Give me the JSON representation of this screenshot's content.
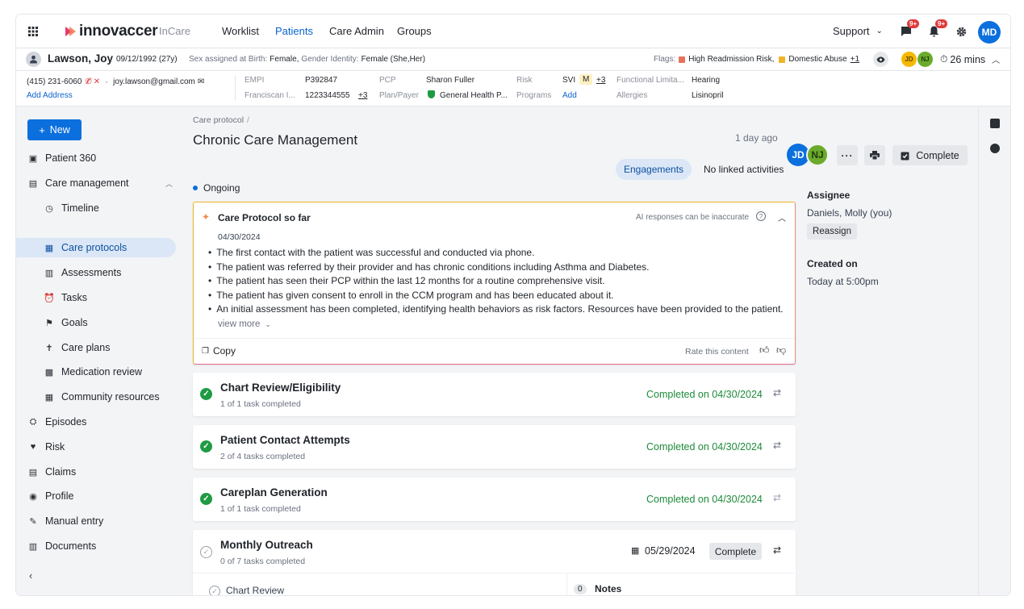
{
  "nav": {
    "brand": "innovaccer",
    "product": "InCare",
    "links": [
      "Worklist",
      "Patients",
      "Care Admin",
      "Groups"
    ],
    "active_link": "Patients",
    "support": "Support",
    "messages_badge": "9+",
    "notifications_badge": "9+",
    "user_initials": "MD"
  },
  "patient": {
    "name": "Lawson, Joy",
    "dob": "09/12/1992 (27y)",
    "sex_label": "Sex assigned at Birth:",
    "sex_value": "Female,",
    "gender_label": "Gender Identity:",
    "gender_value": "Female (She,Her)",
    "flags_label": "Flags:",
    "flag1": "High Readmission Risk,",
    "flag2": "Domestic Abuse",
    "flag_more": "+1",
    "timer": "26 mins",
    "care_team": [
      "JD",
      "NJ"
    ]
  },
  "info": {
    "phone": "(415) 231-6060",
    "email": "joy.lawson@gmail.com",
    "add_address": "Add Address",
    "empi_label": "EMPI",
    "empi_value": "P392847",
    "franciscan_label": "Franciscan I...",
    "franciscan_value": "1223344555",
    "franciscan_more": "+3",
    "pcp_label": "PCP",
    "pcp_value": "Sharon Fuller",
    "plan_label": "Plan/Payer",
    "plan_value": "General Health P...",
    "risk_label": "Risk",
    "risk_value": "SVI",
    "risk_level": "M",
    "risk_more": "+3",
    "programs_label": "Programs",
    "programs_value": "Add",
    "functional_label": "Functional Limita...",
    "functional_value": "Hearing",
    "allergies_label": "Allergies",
    "allergies_value": "Lisinopril"
  },
  "sidebar": {
    "new_label": "New",
    "items": [
      {
        "label": "Patient 360",
        "icon": "id-card-icon"
      },
      {
        "label": "Care management",
        "icon": "chat-icon"
      },
      {
        "label": "Timeline",
        "icon": "history-icon"
      },
      {
        "label": "Care protocols",
        "icon": "protocol-icon"
      },
      {
        "label": "Assessments",
        "icon": "clipboard-icon"
      },
      {
        "label": "Tasks",
        "icon": "alarm-icon"
      },
      {
        "label": "Goals",
        "icon": "goal-icon"
      },
      {
        "label": "Care plans",
        "icon": "care-plan-icon"
      },
      {
        "label": "Medication review",
        "icon": "medication-icon"
      },
      {
        "label": "Community resources",
        "icon": "building-icon"
      },
      {
        "label": "Episodes",
        "icon": "episodes-icon"
      },
      {
        "label": "Risk",
        "icon": "heart-icon"
      },
      {
        "label": "Claims",
        "icon": "claims-icon"
      },
      {
        "label": "Profile",
        "icon": "profile-icon"
      },
      {
        "label": "Manual entry",
        "icon": "manual-entry-icon"
      },
      {
        "label": "Documents",
        "icon": "documents-icon"
      }
    ]
  },
  "main": {
    "breadcrumb": "Care protocol",
    "breadcrumb_sep": "/",
    "title": "Chronic Care Management",
    "updated": "1 day ago",
    "assignees": [
      "JD",
      "NJ"
    ],
    "complete_label": "Complete",
    "engagements_label": "Engagements",
    "linked": "No linked activities",
    "status": "Ongoing",
    "assignee_label": "Assignee",
    "assignee_value": "Daniels, Molly (you)",
    "reassign_label": "Reassign",
    "created_label": "Created on",
    "created_value": "Today at 5:00pm"
  },
  "ai_card": {
    "title": "Care Protocol so far",
    "disclaimer": "AI responses can be inaccurate",
    "date": "04/30/2024",
    "bullets": [
      "The first contact with the patient was successful and conducted via phone.",
      "The patient was referred by their provider and has chronic conditions including Asthma and Diabetes.",
      "The patient has seen their PCP within the last 12 months for a routine comprehensive visit.",
      "The patient has given consent to enroll in the CCM program and has been educated about it.",
      "An initial assessment has been completed, identifying health behaviors as risk factors. Resources have been provided to the patient."
    ],
    "view_more": "view more",
    "copy_label": "Copy",
    "rate_label": "Rate this content"
  },
  "tasks": [
    {
      "title": "Chart Review/Eligibility",
      "progress": "1 of 1 task completed",
      "status": "Completed on 04/30/2024"
    },
    {
      "title": "Patient Contact Attempts",
      "progress": "2 of 4 tasks completed",
      "status": "Completed on 04/30/2024"
    },
    {
      "title": "Careplan Generation",
      "progress": "1 of 1 task completed",
      "status": "Completed on 04/30/2024"
    }
  ],
  "outreach": {
    "title": "Monthly Outreach",
    "progress": "0 of 7 tasks completed",
    "date": "05/29/2024",
    "complete_label": "Complete",
    "subtask": "Chart Review",
    "notes_count": "0",
    "notes_label": "Notes"
  },
  "colors": {
    "accent": "#0b6fde",
    "success": "#1e8a3a",
    "flag_red": "#e8715a",
    "flag_yellow": "#f0b429"
  }
}
